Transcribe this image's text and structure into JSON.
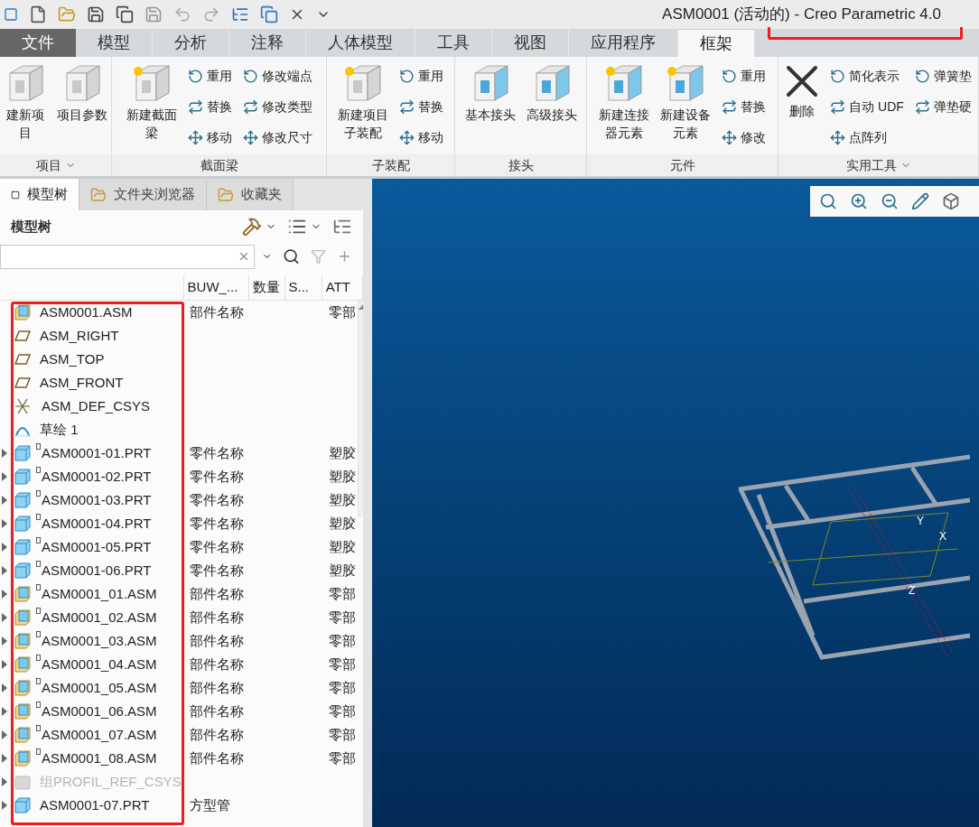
{
  "window": {
    "title": "ASM0001 (活动的) - Creo Parametric 4.0"
  },
  "ribbon_tabs": [
    {
      "label": "文件",
      "kind": "file",
      "selected": false
    },
    {
      "label": "模型",
      "kind": "tab",
      "selected": false
    },
    {
      "label": "分析",
      "kind": "tab",
      "selected": false
    },
    {
      "label": "注释",
      "kind": "tab",
      "selected": false
    },
    {
      "label": "人体模型",
      "kind": "tab",
      "selected": false
    },
    {
      "label": "工具",
      "kind": "tab",
      "selected": false
    },
    {
      "label": "视图",
      "kind": "tab",
      "selected": false
    },
    {
      "label": "应用程序",
      "kind": "tab",
      "selected": false
    },
    {
      "label": "框架",
      "kind": "tab",
      "selected": true
    }
  ],
  "ribbon_groups": [
    {
      "label": "项目",
      "menu": true,
      "columns": [
        [
          {
            "kind": "large",
            "label": [
              "建新项",
              "目"
            ]
          }
        ],
        [
          {
            "kind": "large",
            "label": [
              "项目参数"
            ]
          }
        ]
      ]
    },
    {
      "label": "截面梁",
      "menu": false,
      "columns": [
        [
          {
            "kind": "large",
            "label": [
              "新建截面",
              "梁"
            ]
          }
        ],
        [
          {
            "kind": "small",
            "label": "重用"
          },
          {
            "kind": "small",
            "label": "替换"
          },
          {
            "kind": "small",
            "label": "移动"
          }
        ],
        [
          {
            "kind": "small",
            "label": "修改端点"
          },
          {
            "kind": "small",
            "label": "修改类型"
          },
          {
            "kind": "small",
            "label": "修改尺寸"
          }
        ]
      ]
    },
    {
      "label": "子装配",
      "menu": false,
      "columns": [
        [
          {
            "kind": "large",
            "label": [
              "新建项目",
              "子装配"
            ]
          }
        ],
        [
          {
            "kind": "small",
            "label": "重用"
          },
          {
            "kind": "small",
            "label": "替换"
          },
          {
            "kind": "small",
            "label": "移动"
          }
        ]
      ]
    },
    {
      "label": "接头",
      "menu": false,
      "columns": [
        [
          {
            "kind": "large",
            "label": [
              "基本接头"
            ]
          }
        ],
        [
          {
            "kind": "large",
            "label": [
              "高级接头"
            ]
          }
        ]
      ]
    },
    {
      "label": "元件",
      "menu": false,
      "columns": [
        [
          {
            "kind": "large",
            "label": [
              "新建连接",
              "器元素"
            ]
          }
        ],
        [
          {
            "kind": "large",
            "label": [
              "新建设备",
              "元素"
            ]
          }
        ],
        [
          {
            "kind": "small",
            "label": "重用"
          },
          {
            "kind": "small",
            "label": "替换"
          },
          {
            "kind": "small",
            "label": "修改"
          }
        ]
      ]
    },
    {
      "label": "实用工具",
      "menu": true,
      "columns": [
        [
          {
            "kind": "large",
            "label": [
              "删除"
            ]
          }
        ],
        [
          {
            "kind": "small",
            "label": "简化表示"
          },
          {
            "kind": "small",
            "label": "自动 UDF"
          },
          {
            "kind": "small",
            "label": "点阵列"
          }
        ],
        [
          {
            "kind": "small",
            "label": "弹簧垫"
          },
          {
            "kind": "small",
            "label": "弹垫硬"
          }
        ]
      ]
    }
  ],
  "panel_tabs": [
    {
      "label": "模型树",
      "selected": true
    },
    {
      "label": "文件夹浏览器",
      "selected": false
    },
    {
      "label": "收藏夹",
      "selected": false
    }
  ],
  "model_tree": {
    "title": "模型树",
    "columns": [
      "BUW_...",
      "数量",
      "S...",
      "ATT"
    ],
    "rows": [
      {
        "name": "ASM0001.ASM",
        "kind": "assembly",
        "expandable": false,
        "marker": false,
        "disabled": false,
        "buw": "部件名称",
        "att": "零部"
      },
      {
        "name": "ASM_RIGHT",
        "kind": "plane",
        "expandable": false,
        "marker": false,
        "disabled": false
      },
      {
        "name": "ASM_TOP",
        "kind": "plane",
        "expandable": false,
        "marker": false,
        "disabled": false
      },
      {
        "name": "ASM_FRONT",
        "kind": "plane",
        "expandable": false,
        "marker": false,
        "disabled": false
      },
      {
        "name": "ASM_DEF_CSYS",
        "kind": "csys",
        "expandable": false,
        "marker": false,
        "disabled": false
      },
      {
        "name": "草绘 1",
        "kind": "sketch",
        "expandable": false,
        "marker": false,
        "disabled": false
      },
      {
        "name": "ASM0001-01.PRT",
        "kind": "part",
        "expandable": true,
        "marker": true,
        "disabled": false,
        "buw": "零件名称",
        "att": "塑胶"
      },
      {
        "name": "ASM0001-02.PRT",
        "kind": "part",
        "expandable": true,
        "marker": true,
        "disabled": false,
        "buw": "零件名称",
        "att": "塑胶"
      },
      {
        "name": "ASM0001-03.PRT",
        "kind": "part",
        "expandable": true,
        "marker": true,
        "disabled": false,
        "buw": "零件名称",
        "att": "塑胶"
      },
      {
        "name": "ASM0001-04.PRT",
        "kind": "part",
        "expandable": true,
        "marker": true,
        "disabled": false,
        "buw": "零件名称",
        "att": "塑胶"
      },
      {
        "name": "ASM0001-05.PRT",
        "kind": "part",
        "expandable": true,
        "marker": true,
        "disabled": false,
        "buw": "零件名称",
        "att": "塑胶"
      },
      {
        "name": "ASM0001-06.PRT",
        "kind": "part",
        "expandable": true,
        "marker": true,
        "disabled": false,
        "buw": "零件名称",
        "att": "塑胶"
      },
      {
        "name": "ASM0001_01.ASM",
        "kind": "assembly",
        "expandable": true,
        "marker": true,
        "disabled": false,
        "buw": "部件名称",
        "att": "零部"
      },
      {
        "name": "ASM0001_02.ASM",
        "kind": "assembly",
        "expandable": true,
        "marker": true,
        "disabled": false,
        "buw": "部件名称",
        "att": "零部"
      },
      {
        "name": "ASM0001_03.ASM",
        "kind": "assembly",
        "expandable": true,
        "marker": true,
        "disabled": false,
        "buw": "部件名称",
        "att": "零部"
      },
      {
        "name": "ASM0001_04.ASM",
        "kind": "assembly",
        "expandable": true,
        "marker": true,
        "disabled": false,
        "buw": "部件名称",
        "att": "零部"
      },
      {
        "name": "ASM0001_05.ASM",
        "kind": "assembly",
        "expandable": true,
        "marker": true,
        "disabled": false,
        "buw": "部件名称",
        "att": "零部"
      },
      {
        "name": "ASM0001_06.ASM",
        "kind": "assembly",
        "expandable": true,
        "marker": true,
        "disabled": false,
        "buw": "部件名称",
        "att": "零部"
      },
      {
        "name": "ASM0001_07.ASM",
        "kind": "assembly",
        "expandable": true,
        "marker": true,
        "disabled": false,
        "buw": "部件名称",
        "att": "零部"
      },
      {
        "name": "ASM0001_08.ASM",
        "kind": "assembly",
        "expandable": true,
        "marker": true,
        "disabled": false,
        "buw": "部件名称",
        "att": "零部"
      },
      {
        "name": "组PROFIL_REF_CSYS",
        "kind": "group",
        "expandable": true,
        "marker": false,
        "disabled": true
      },
      {
        "name": "ASM0001-07.PRT",
        "kind": "part",
        "expandable": true,
        "marker": false,
        "disabled": false,
        "buw": "方型管"
      }
    ]
  },
  "viewport": {
    "axes": [
      "Y",
      "X",
      "Z"
    ]
  }
}
